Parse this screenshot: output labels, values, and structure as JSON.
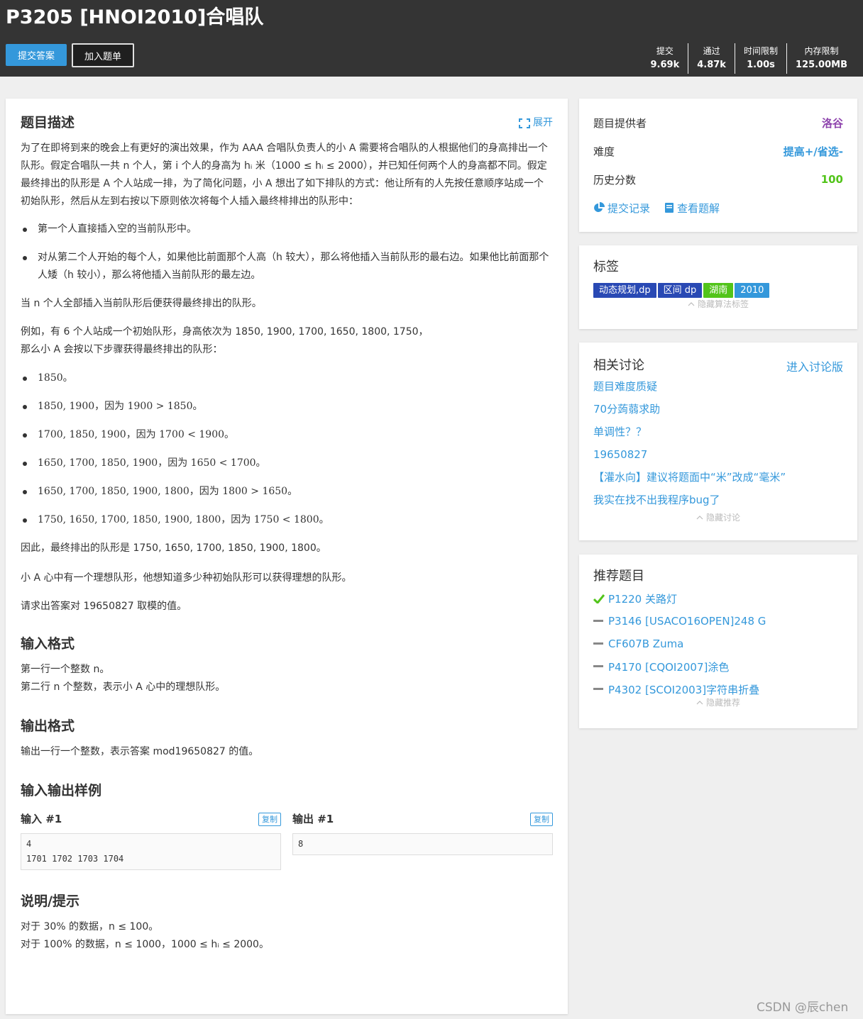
{
  "header": {
    "title": "P3205 [HNOI2010]合唱队",
    "submit_label": "提交答案",
    "add_label": "加入题单",
    "stats": [
      {
        "label": "提交",
        "value": "9.69k"
      },
      {
        "label": "通过",
        "value": "4.87k"
      },
      {
        "label": "时间限制",
        "value": "1.00s"
      },
      {
        "label": "内存限制",
        "value": "125.00MB"
      }
    ]
  },
  "main": {
    "desc_title": "题目描述",
    "expand_label": "展开",
    "p1": "为了在即将到来的晚会上有更好的演出效果，作为 AAA 合唱队负责人的小 A 需要将合唱队的人根据他们的身高排出一个队形。假定合唱队一共 n 个人，第 i 个人的身高为 hᵢ 米（1000 ≤ hᵢ ≤ 2000），并已知任何两个人的身高都不同。假定最终排出的队形是 A 个人站成一排，为了简化问题，小 A 想出了如下排队的方式：他让所有的人先按任意顺序站成一个初始队形，然后从左到右按以下原则依次将每个人插入最终棑排出的队形中：",
    "rules": [
      "第一个人直接插入空的当前队形中。",
      "对从第二个人开始的每个人，如果他比前面那个人高（h 较大），那么将他插入当前队形的最右边。如果他比前面那个人矮（h 较小），那么将他插入当前队形的最左边。"
    ],
    "p2": "当 n 个人全部插入当前队形后便获得最终排出的队形。",
    "p3a": "例如，有 6 个人站成一个初始队形，身高依次为 1850, 1900, 1700, 1650, 1800, 1750，",
    "p3b": "那么小 A 会按以下步骤获得最终排出的队形：",
    "steps": [
      "1850。",
      "1850, 1900，因为 1900 > 1850。",
      "1700, 1850, 1900，因为 1700 < 1900。",
      "1650, 1700, 1850, 1900，因为 1650 < 1700。",
      "1650, 1700, 1850, 1900, 1800，因为 1800 > 1650。",
      "1750, 1650, 1700, 1850, 1900, 1800，因为 1750 < 1800。"
    ],
    "p4": "因此，最终排出的队形是 1750, 1650, 1700, 1850, 1900, 1800。",
    "p5": "小 A 心中有一个理想队形，他想知道多少种初始队形可以获得理想的队形。",
    "p6": "请求出答案对 19650827 取模的值。",
    "input_title": "输入格式",
    "input_l1": "第一行一个整数 n。",
    "input_l2": "第二行 n 个整数，表示小 A 心中的理想队形。",
    "output_title": "输出格式",
    "output_l1": "输出一行一个整数，表示答案 mod19650827 的值。",
    "samples_title": "输入输出样例",
    "in_label": "输入 #1",
    "out_label": "输出 #1",
    "copy_label": "复制",
    "sample_in": "4\n1701 1702 1703 1704",
    "sample_out": "8",
    "hint_title": "说明/提示",
    "hint_l1": "对于 30% 的数据，n ≤ 100。",
    "hint_l2": "对于 100% 的数据，n ≤ 1000，1000 ≤ hᵢ ≤ 2000。"
  },
  "info": {
    "provider_label": "题目提供者",
    "provider_value": "洛谷",
    "difficulty_label": "难度",
    "difficulty_value": "提高+/省选-",
    "history_label": "历史分数",
    "history_value": "100",
    "records_label": "提交记录",
    "solutions_label": "查看题解"
  },
  "tags": {
    "title": "标签",
    "items": [
      "动态规划,dp",
      "区间 dp",
      "湖南",
      "2010"
    ],
    "hide_label": "隐藏算法标签"
  },
  "discuss": {
    "title": "相关讨论",
    "enter_label": "进入讨论版",
    "items": [
      "题目难度质疑",
      "70分蒟蒻求助",
      "单调性？？",
      "19650827",
      "【灌水向】建议将题面中“米”改成“毫米”",
      "我实在找不出我程序bug了"
    ],
    "hide_label": "隐藏讨论"
  },
  "recommend": {
    "title": "推荐题目",
    "items": [
      "P1220 关路灯",
      "P3146 [USACO16OPEN]248 G",
      "CF607B Zuma",
      "P4170 [CQOI2007]涂色",
      "P4302 [SCOI2003]字符串折叠"
    ],
    "hide_label": "隐藏推荐"
  },
  "watermark": "CSDN @辰chen",
  "colors": {
    "header_bg": "#343434",
    "accent_blue": "#3498db",
    "provider_purple": "#8e44ad",
    "difficulty_blue": "#3498db",
    "score_green": "#52c41a",
    "tag_blue": "#2949b4",
    "tag_green": "#52c41a",
    "tag_light_blue": "#3498db"
  }
}
